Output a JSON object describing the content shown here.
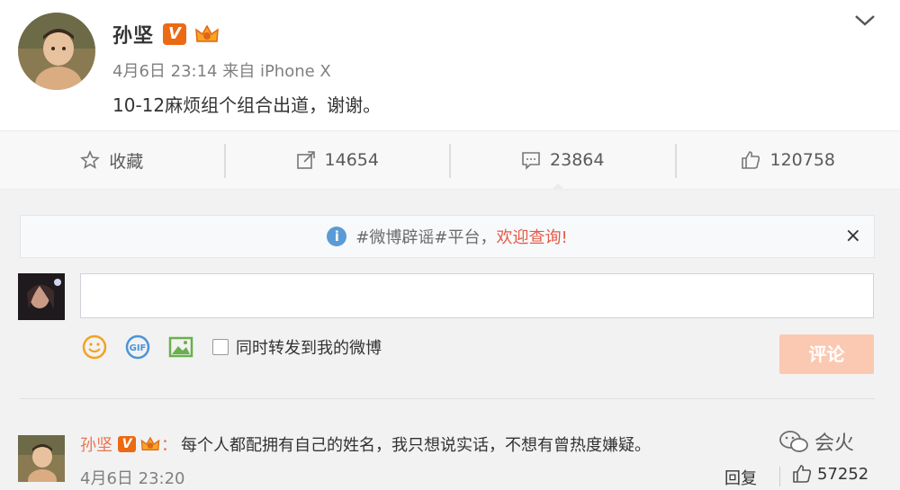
{
  "post": {
    "author": "孙坚",
    "verified_badge": "V",
    "time_source": "4月6日 23:14 来自 iPhone X",
    "text": "10-12麻烦组个组合出道，谢谢。"
  },
  "actions": {
    "favorite_label": "收藏",
    "repost_count": "14654",
    "comment_count": "23864",
    "like_count": "120758"
  },
  "notice": {
    "text_prefix": "#微博辟谣#平台，",
    "text_highlight": "欢迎查询!",
    "close_glyph": "×"
  },
  "composer": {
    "input_value": "",
    "repost_checkbox_label": "同时转发到我的微博",
    "submit_label": "评论"
  },
  "comment": {
    "author": "孙坚",
    "verified_badge": "V",
    "colon": "：",
    "text": "每个人都配拥有自己的姓名，我只想说实话，不想有曾热度嫌疑。",
    "time": "4月6日 23:20",
    "reply_label": "回复",
    "like_count": "57252"
  },
  "watermark": {
    "text": "会火"
  },
  "colors": {
    "accent_orange": "#eb7350",
    "badge_orange": "#ec6a13",
    "submit_disabled": "#fbc8b1",
    "info_blue": "#5a9bd5"
  }
}
